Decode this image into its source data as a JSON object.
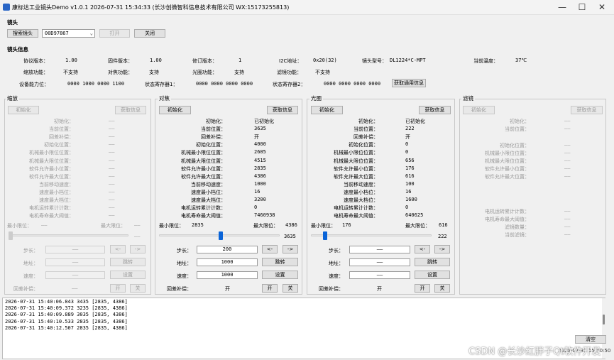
{
  "window": {
    "title": "康标达工业镜头Demo v1.0.1 2026-07-31 15:34:33 (长沙创微智科信息技术有限公司 WX:15173255813)",
    "minimize": "—",
    "maximize": "☐",
    "close": "✕"
  },
  "lens_section": {
    "title": "镜头",
    "search_btn": "搜索镜头",
    "device_id": "00D97867",
    "open_btn": "打开",
    "close_btn": "关闭"
  },
  "info": {
    "title": "镜头信息",
    "protocol_label": "协议版本：",
    "protocol": "1.00",
    "firmware_label": "固件版本：",
    "firmware": "1.00",
    "revision_label": "修订版本：",
    "revision": "1",
    "i2c_label": "I2C地址：",
    "i2c": "0x20(32)",
    "model_label": "镜头型号：",
    "model": "DL1224*C-MPT",
    "temp_label": "当前温度：",
    "temp": "37℃",
    "zoom_label": "缩放功能：",
    "zoom": "不支持",
    "focus_label": "对焦功能：",
    "focus": "支持",
    "iris_label": "光圈功能：",
    "iris": "支持",
    "filter_label": "滤镜功能：",
    "filter": "不支持",
    "cap_label": "设备能力位：",
    "cap": "0000 1000 0000 1100",
    "status1_label": "状态寄存器1：",
    "status1": "0000 0000 0000 0000",
    "status2_label": "状态寄存器2：",
    "status2": "0000 0000 0000 0000",
    "get_general_btn": "获取通用信息"
  },
  "zoom": {
    "title": "缩放",
    "init_btn": "初始化",
    "get_btn": "获取信息",
    "rows": [
      {
        "label": "初始化：",
        "value": "——"
      },
      {
        "label": "当前位置：",
        "value": "——"
      },
      {
        "label": "回差补偿：",
        "value": "——"
      },
      {
        "label": "初始化位置：",
        "value": "——"
      },
      {
        "label": "机械最小限位位置：",
        "value": "——"
      },
      {
        "label": "机械最大限位位置：",
        "value": "——"
      },
      {
        "label": "软件允许最小位置：",
        "value": "——"
      },
      {
        "label": "软件允许最大位置：",
        "value": "——"
      },
      {
        "label": "当前移动速度：",
        "value": "——"
      },
      {
        "label": "速度最小档位：",
        "value": "——"
      },
      {
        "label": "速度最大档位：",
        "value": "——"
      },
      {
        "label": "电机运转累计计数：",
        "value": "——"
      },
      {
        "label": "电机寿命最大阈值：",
        "value": "——"
      }
    ],
    "min_label": "最小限位：",
    "min_val": "——",
    "max_label": "最大限位：",
    "max_val": "——",
    "slider_val": "——",
    "slider_pos": 0,
    "step_label": "步长：",
    "step_val": "——",
    "addr_label": "地址：",
    "addr_val": "——",
    "jump_btn": "跳转",
    "speed_label": "速度：",
    "speed_val": "——",
    "set_btn": "设置",
    "backlash_label": "回差补偿：",
    "backlash_val": "——",
    "on_btn": "开",
    "off_btn": "关",
    "left_btn": "<-",
    "right_btn": "->"
  },
  "focus": {
    "title": "对焦",
    "init_btn": "初始化",
    "get_btn": "获取信息",
    "rows": [
      {
        "label": "初始化：",
        "value": "已初始化"
      },
      {
        "label": "当前位置：",
        "value": "3635"
      },
      {
        "label": "回差补偿：",
        "value": "开"
      },
      {
        "label": "初始化位置：",
        "value": "4000"
      },
      {
        "label": "机械最小限位位置：",
        "value": "2605"
      },
      {
        "label": "机械最大限位位置：",
        "value": "4515"
      },
      {
        "label": "软件允许最小位置：",
        "value": "2835"
      },
      {
        "label": "软件允许最大位置：",
        "value": "4386"
      },
      {
        "label": "当前移动速度：",
        "value": "1000"
      },
      {
        "label": "速度最小档位：",
        "value": "16"
      },
      {
        "label": "速度最大档位：",
        "value": "3200"
      },
      {
        "label": "电机运转累计计数：",
        "value": "0"
      },
      {
        "label": "电机寿命最大阈值：",
        "value": "7460938"
      }
    ],
    "min_label": "最小限位：",
    "min_val": "2835",
    "max_label": "最大限位：",
    "max_val": "4386",
    "slider_val": "3635",
    "slider_pos": 0.515,
    "step_label": "步长：",
    "step_val": "200",
    "addr_label": "地址：",
    "addr_val": "1000",
    "jump_btn": "跳转",
    "speed_label": "速度：",
    "speed_val": "1000",
    "set_btn": "设置",
    "backlash_label": "回差补偿：",
    "backlash_val": "开",
    "on_btn": "开",
    "off_btn": "关",
    "left_btn": "<-",
    "right_btn": "->"
  },
  "iris": {
    "title": "光圈",
    "init_btn": "初始化",
    "get_btn": "获取信息",
    "rows": [
      {
        "label": "初始化：",
        "value": "已初始化"
      },
      {
        "label": "当前位置：",
        "value": "222"
      },
      {
        "label": "回差补偿：",
        "value": "开"
      },
      {
        "label": "初始化位置：",
        "value": "0"
      },
      {
        "label": "机械最小限位位置：",
        "value": "0"
      },
      {
        "label": "机械最大限位位置：",
        "value": "656"
      },
      {
        "label": "软件允许最小位置：",
        "value": "176"
      },
      {
        "label": "软件允许最大位置：",
        "value": "616"
      },
      {
        "label": "当前移动速度：",
        "value": "100"
      },
      {
        "label": "速度最小档位：",
        "value": "16"
      },
      {
        "label": "速度最大档位：",
        "value": "1600"
      },
      {
        "label": "电机运转累计计数：",
        "value": "0"
      },
      {
        "label": "电机寿命最大阈值：",
        "value": "640625"
      }
    ],
    "min_label": "最小限位：",
    "min_val": "176",
    "max_label": "最大限位：",
    "max_val": "616",
    "slider_val": "222",
    "slider_pos": 0.105,
    "step_label": "步长：",
    "step_val": "——",
    "addr_label": "地址：",
    "addr_val": "——",
    "jump_btn": "跳转",
    "speed_label": "速度：",
    "speed_val": "——",
    "set_btn": "设置",
    "backlash_label": "回差补偿：",
    "backlash_val": "开",
    "on_btn": "开",
    "off_btn": "关",
    "left_btn": "<-",
    "right_btn": "->"
  },
  "filter": {
    "title": "滤镜",
    "init_btn": "初始化",
    "get_btn": "获取信息",
    "rows_top": [
      {
        "label": "初始化：",
        "value": "——"
      },
      {
        "label": "当前位置：",
        "value": "——"
      }
    ],
    "rows_mid": [
      {
        "label": "初始化位置：",
        "value": "——"
      },
      {
        "label": "机械最小限位位置：",
        "value": "——"
      },
      {
        "label": "机械最大限位位置：",
        "value": "——"
      },
      {
        "label": "软件允许最小位置：",
        "value": "——"
      },
      {
        "label": "软件允许最大位置：",
        "value": "——"
      }
    ],
    "rows_bot": [
      {
        "label": "电机运转累计计数：",
        "value": "——"
      },
      {
        "label": "电机寿命最大阈值：",
        "value": "——"
      },
      {
        "label": "滤镜数量：",
        "value": "——"
      },
      {
        "label": "当前滤镜：",
        "value": "——"
      }
    ]
  },
  "log": {
    "lines": [
      "2026-07-31 15:40:06.843 3435 [2835, 4386]",
      "2026-07-31 15:40:09.372 3235 [2835, 4386]",
      "2026-07-31 15:40:09.889 3035 [2835, 4386]",
      "2026-07-31 15:40:10.533 2835 [2835, 4386]",
      "2026-07-31 15:40:12.507 2835 [2835, 4386]"
    ],
    "clear_btn": "清空"
  },
  "status_time": "2026-07-31 15:40:50",
  "watermark": "CSDN @长沙红胖子Qt软件开发"
}
